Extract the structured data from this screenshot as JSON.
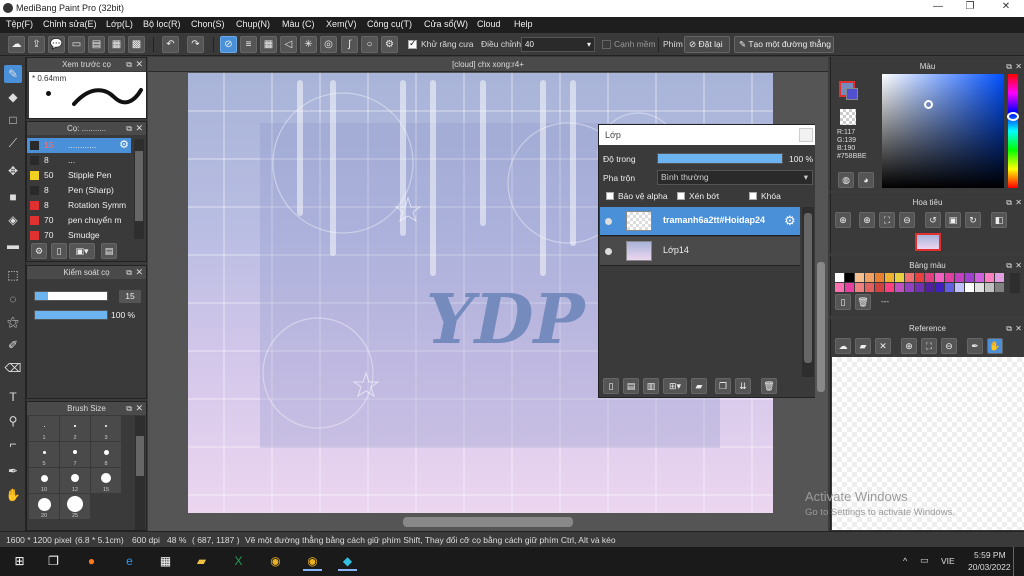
{
  "app": {
    "title": "MediBang Paint Pro (32bit)",
    "doc_tab": "[cloud] chx xong:r4+"
  },
  "menu": [
    "Tệp(F)",
    "Chỉnh sửa(E)",
    "Lớp(L)",
    "Bộ lọc(R)",
    "Chọn(S)",
    "Chụp(N)",
    "Màu (C)",
    "Xem(V)",
    "Công cụ(T)",
    "Cửa sổ(W)",
    "Cloud",
    "Help"
  ],
  "toolbar": {
    "antialias_label": "Khử răng cưa",
    "adjust_label": "Điều chỉnh",
    "adjust_value": "40",
    "soft_edge_label": "Cạnh mềm",
    "key_label": "Phím",
    "reset_label": "Đặt lại",
    "straight_line_label": "Tạo một đường thẳng"
  },
  "brush_preview": {
    "title": "Xem trước cọ",
    "size": "0.64mm"
  },
  "brush_panel": {
    "title": "Cọ: ...........",
    "items": [
      {
        "size": "15",
        "name": "............",
        "color": "#2a2a2a",
        "selected": true
      },
      {
        "size": "8",
        "name": "...",
        "color": "#2a2a2a"
      },
      {
        "size": "50",
        "name": "Stipple Pen",
        "color": "#f0d020"
      },
      {
        "size": "8",
        "name": "Pen (Sharp)",
        "color": "#2a2a2a"
      },
      {
        "size": "8",
        "name": "Rotation Symm",
        "color": "#e03030"
      },
      {
        "size": "70",
        "name": "pen chuyển m",
        "color": "#e03030"
      },
      {
        "size": "70",
        "name": "Smudge",
        "color": "#e03030"
      }
    ]
  },
  "brush_control": {
    "title": "Kiểm soát cọ",
    "size_value": "15",
    "opacity_value": "100 %",
    "size_fraction": 0.18,
    "opacity_fraction": 1.0
  },
  "brush_size": {
    "title": "Brush Size",
    "labels": [
      "1",
      "2",
      "3",
      "5",
      "7",
      "8",
      "10",
      "12",
      "15",
      "20",
      "25"
    ]
  },
  "layer_panel": {
    "title": "Lớp",
    "opacity_label": "Độ trong",
    "opacity_value": "100 %",
    "opacity_fraction": 1.0,
    "blend_label": "Pha trộn",
    "blend_value": "Bình thường",
    "protect_alpha": "Bảo vệ alpha",
    "clipping": "Xén bớt",
    "lock": "Khóa",
    "layers": [
      {
        "name": "tramanh6a2tt#Hoidap24",
        "selected": true
      },
      {
        "name": "Lớp14",
        "selected": false
      }
    ]
  },
  "color_panel": {
    "title": "Màu",
    "r": "R:117",
    "g": "G:139",
    "b": "B:190",
    "hex": "#758BBE",
    "main_color": "#758BBE"
  },
  "navigator_panel": {
    "title": "Hoa tiêu"
  },
  "palette_panel": {
    "title": "Bảng màu",
    "row1": [
      "#ffffff",
      "#000000",
      "#f5c090",
      "#f0a060",
      "#e88030",
      "#f0b030",
      "#e8d040",
      "#f07070",
      "#e84040",
      "#e04080",
      "#f060c0",
      "#e040a0",
      "#c040c0",
      "#a040d0",
      "#d060e0",
      "#ff80c0",
      "#e0a0e0"
    ],
    "row2": [
      "#ff70b0",
      "#e840a0",
      "#f08080",
      "#e06060",
      "#d04040",
      "#ff4080",
      "#c050c0",
      "#9040c0",
      "#7030b0",
      "#5020a0",
      "#4020c0",
      "#6060e0",
      "#c0c0ff",
      "#ffffff",
      "#e0e0e0",
      "#c0c0c0",
      "#808080"
    ],
    "item_label": "---"
  },
  "reference_panel": {
    "title": "Reference"
  },
  "canvas_art": {
    "text": "YDP"
  },
  "status": {
    "dimensions": "1600 * 1200 pixel",
    "physical": "(6.8 * 5.1cm)",
    "dpi": "600 dpi",
    "zoom": "48 %",
    "coords": "( 687, 1187 )",
    "hint": "Vẽ một đường thẳng bằng cách giữ phím Shift, Thay đổi cỡ cọ bằng cách giữ phím Ctrl, Alt và kéo"
  },
  "watermark": {
    "line1": "Activate Windows",
    "line2": "Go to Settings to activate Windows."
  },
  "taskbar": {
    "lang": "VIE",
    "time": "5:59 PM",
    "date": "20/03/2022"
  }
}
